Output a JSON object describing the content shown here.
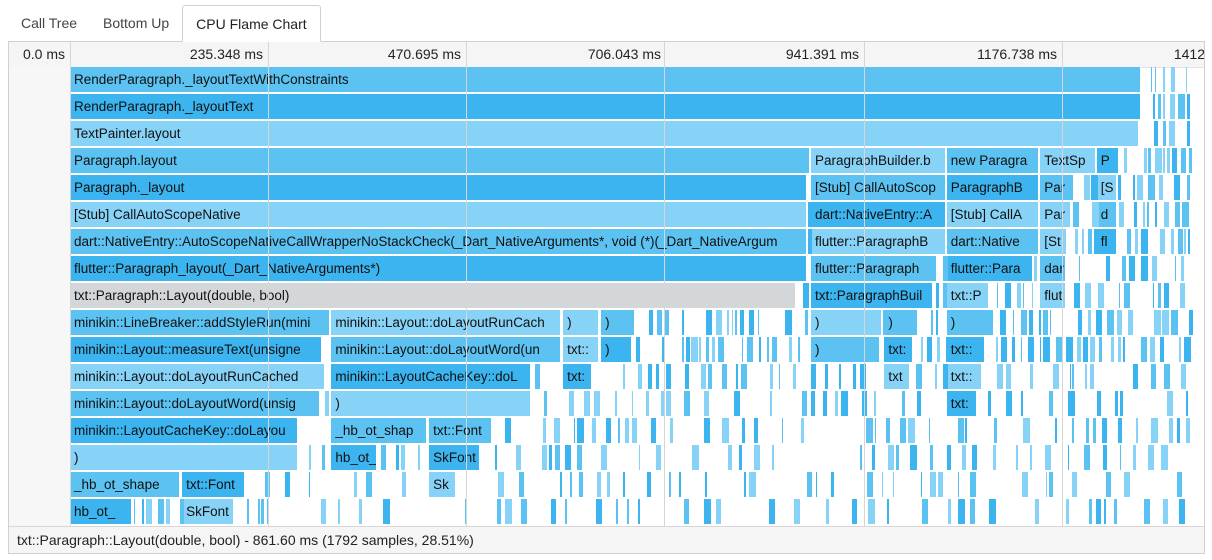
{
  "tabs": [
    {
      "label": "Call Tree",
      "active": false
    },
    {
      "label": "Bottom Up",
      "active": false
    },
    {
      "label": "CPU Flame Chart",
      "active": true
    }
  ],
  "ruler": {
    "ticks": [
      "0.0 ms",
      "235.348 ms",
      "470.695 ms",
      "706.043 ms",
      "941.391 ms",
      "1176.738 ms",
      "1412"
    ]
  },
  "colors": {
    "light": "#87d2f7",
    "mid": "#5bc2f2",
    "dark": "#3bb4ef",
    "selected": "#d4d7da"
  },
  "flame": {
    "total_ms": 1412.087,
    "rows": [
      [
        {
          "label": "RenderParagraph._layoutTextWithConstraints",
          "start": 0,
          "dur": 1271,
          "shade": "mid"
        }
      ],
      [
        {
          "label": "RenderParagraph._layoutText",
          "start": 0,
          "dur": 1271,
          "shade": "dark"
        }
      ],
      [
        {
          "label": "TextPainter.layout",
          "start": 0,
          "dur": 1268,
          "shade": "light"
        }
      ],
      [
        {
          "label": "Paragraph.layout",
          "start": 0,
          "dur": 878,
          "shade": "mid"
        },
        {
          "label": "ParagraphBuilder.b",
          "start": 879,
          "dur": 160,
          "shade": "light"
        },
        {
          "label": "new Paragra",
          "start": 1040,
          "dur": 110,
          "shade": "mid"
        },
        {
          "label": "TextSp",
          "start": 1151,
          "dur": 66,
          "shade": "light"
        },
        {
          "label": "P",
          "start": 1218,
          "dur": 26,
          "shade": "dark"
        }
      ],
      [
        {
          "label": "Paragraph._layout",
          "start": 0,
          "dur": 874,
          "shade": "dark"
        },
        {
          "label": "[Stub] CallAutoScop",
          "start": 879,
          "dur": 160,
          "shade": "mid"
        },
        {
          "label": "ParagraphB",
          "start": 1040,
          "dur": 110,
          "shade": "dark"
        },
        {
          "label": "Par",
          "start": 1151,
          "dur": 40,
          "shade": "mid"
        },
        {
          "label": "[S",
          "start": 1218,
          "dur": 24,
          "shade": "light"
        }
      ],
      [
        {
          "label": "[Stub] CallAutoScopeNative",
          "start": 0,
          "dur": 874,
          "shade": "light"
        },
        {
          "label": "dart::NativeEntry::A",
          "start": 879,
          "dur": 160,
          "shade": "dark"
        },
        {
          "label": "[Stub] CallA",
          "start": 1040,
          "dur": 110,
          "shade": "light"
        },
        {
          "label": "Par",
          "start": 1151,
          "dur": 36,
          "shade": "light"
        },
        {
          "label": "d",
          "start": 1218,
          "dur": 24,
          "shade": "mid"
        }
      ],
      [
        {
          "label": "dart::NativeEntry::AutoScopeNativeCallWrapperNoStackCheck(_Dart_NativeArguments*, void (*)(_Dart_NativeArgum",
          "start": 0,
          "dur": 874,
          "shade": "mid"
        },
        {
          "label": "flutter::ParagraphB",
          "start": 879,
          "dur": 160,
          "shade": "light"
        },
        {
          "label": "dart::Native",
          "start": 1040,
          "dur": 110,
          "shade": "mid"
        },
        {
          "label": "[St",
          "start": 1151,
          "dur": 32,
          "shade": "light"
        },
        {
          "label": "fl",
          "start": 1218,
          "dur": 24,
          "shade": "dark"
        }
      ],
      [
        {
          "label": "flutter::Paragraph_layout(_Dart_NativeArguments*)",
          "start": 0,
          "dur": 874,
          "shade": "dark"
        },
        {
          "label": "flutter::Paragraph",
          "start": 879,
          "dur": 150,
          "shade": "mid"
        },
        {
          "label": "flutter::Para",
          "start": 1040,
          "dur": 102,
          "shade": "dark"
        },
        {
          "label": "dar",
          "start": 1151,
          "dur": 30,
          "shade": "mid"
        }
      ],
      [
        {
          "label": "txt::Paragraph::Layout(double, bool)",
          "start": 0,
          "dur": 861.6,
          "shade": "selected"
        },
        {
          "label": "txt::ParagraphBuil",
          "start": 879,
          "dur": 145,
          "shade": "dark"
        },
        {
          "label": "txt::P",
          "start": 1040,
          "dur": 50,
          "shade": "light"
        },
        {
          "label": "flut",
          "start": 1151,
          "dur": 30,
          "shade": "light"
        }
      ],
      [
        {
          "label": "minikin::LineBreaker::addStyleRun(mini",
          "start": 0,
          "dur": 309,
          "shade": "mid"
        },
        {
          "label": "minikin::Layout::doLayoutRunCach",
          "start": 310,
          "dur": 273,
          "shade": "light"
        },
        {
          "label": ")",
          "start": 585,
          "dur": 42,
          "shade": "light"
        },
        {
          "label": ")",
          "start": 630,
          "dur": 40,
          "shade": "mid"
        },
        {
          "label": ")",
          "start": 879,
          "dur": 84,
          "shade": "light"
        },
        {
          "label": ")",
          "start": 966,
          "dur": 40,
          "shade": "mid"
        },
        {
          "label": ")",
          "start": 1040,
          "dur": 56,
          "shade": "mid"
        }
      ],
      [
        {
          "label": "minikin::Layout::measureText(unsigne",
          "start": 0,
          "dur": 299,
          "shade": "dark"
        },
        {
          "label": "minikin::Layout::doLayoutWord(un",
          "start": 310,
          "dur": 273,
          "shade": "mid"
        },
        {
          "label": "txt::",
          "start": 585,
          "dur": 42,
          "shade": "light"
        },
        {
          "label": ")",
          "start": 630,
          "dur": 37,
          "shade": "dark"
        },
        {
          "label": ")",
          "start": 879,
          "dur": 82,
          "shade": "mid"
        },
        {
          "label": "txt:",
          "start": 966,
          "dur": 34,
          "shade": "dark"
        },
        {
          "label": "txt::",
          "start": 1040,
          "dur": 46,
          "shade": "dark"
        }
      ],
      [
        {
          "label": "minikin::Layout::doLayoutRunCached",
          "start": 0,
          "dur": 303,
          "shade": "light"
        },
        {
          "label": "minikin::LayoutCacheKey::doL",
          "start": 310,
          "dur": 237,
          "shade": "dark"
        },
        {
          "label": "txt:",
          "start": 585,
          "dur": 34,
          "shade": "dark"
        },
        {
          "label": "txt",
          "start": 966,
          "dur": 30,
          "shade": "light"
        },
        {
          "label": "txt::",
          "start": 1040,
          "dur": 42,
          "shade": "light"
        }
      ],
      [
        {
          "label": "minikin::Layout::doLayoutWord(unsig",
          "start": 0,
          "dur": 297,
          "shade": "mid"
        },
        {
          "label": ")",
          "start": 310,
          "dur": 237,
          "shade": "light"
        },
        {
          "label": "txt:",
          "start": 1040,
          "dur": 36,
          "shade": "dark"
        }
      ],
      [
        {
          "label": "minikin::LayoutCacheKey::doLayou",
          "start": 0,
          "dur": 271,
          "shade": "dark"
        },
        {
          "label": "_hb_ot_shap",
          "start": 310,
          "dur": 114,
          "shade": "mid"
        },
        {
          "label": "txt::Font",
          "start": 426,
          "dur": 75,
          "shade": "mid"
        }
      ],
      [
        {
          "label": ")",
          "start": 0,
          "dur": 271,
          "shade": "light"
        },
        {
          "label": "hb_ot_",
          "start": 310,
          "dur": 54,
          "shade": "dark"
        },
        {
          "label": "SkFont",
          "start": 426,
          "dur": 60,
          "shade": "dark"
        }
      ],
      [
        {
          "label": "_hb_ot_shape",
          "start": 0,
          "dur": 131,
          "shade": "mid"
        },
        {
          "label": "txt::Font",
          "start": 133,
          "dur": 75,
          "shade": "dark"
        },
        {
          "label": "Sk",
          "start": 426,
          "dur": 32,
          "shade": "light"
        }
      ],
      [
        {
          "label": "hb_ot_",
          "start": 0,
          "dur": 74,
          "shade": "dark"
        },
        {
          "label": "SkFont",
          "start": 133,
          "dur": 62,
          "shade": "light"
        }
      ]
    ]
  },
  "status": {
    "text": "txt::Paragraph::Layout(double, bool) - 861.60 ms (1792 samples, 28.51%)"
  }
}
